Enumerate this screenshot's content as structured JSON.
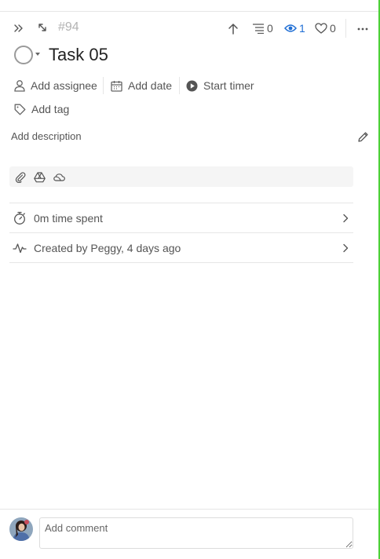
{
  "task": {
    "id": "#94",
    "title": "Task 05"
  },
  "counters": {
    "subtasks": "0",
    "watchers": "1",
    "likes": "0"
  },
  "properties": {
    "assignee_label": "Add assignee",
    "date_label": "Add date",
    "timer_label": "Start timer",
    "tag_label": "Add tag"
  },
  "description": {
    "placeholder": "Add description"
  },
  "activity": {
    "time_spent": "0m time spent",
    "created": "Created by Peggy, 4 days ago"
  },
  "comment": {
    "placeholder": "Add comment"
  },
  "colors": {
    "accent": "#1f6ed4",
    "edge": "#4cd137"
  }
}
